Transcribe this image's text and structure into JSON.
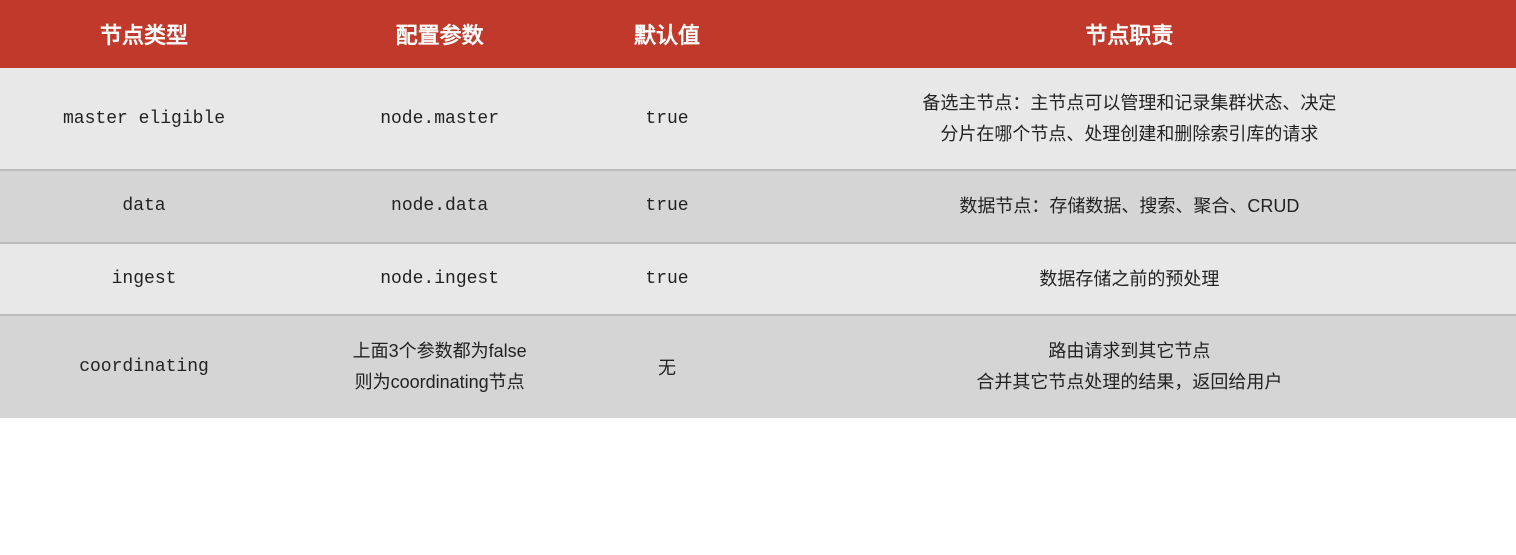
{
  "table": {
    "headers": {
      "col1": "节点类型",
      "col2": "配置参数",
      "col3": "默认值",
      "col4": "节点职责"
    },
    "rows": [
      {
        "type": "master eligible",
        "param": "node.master",
        "default": "true",
        "desc_line1": "备选主节点：主节点可以管理和记录集群状态、决定",
        "desc_line2": "分片在哪个节点、处理创建和删除索引库的请求"
      },
      {
        "type": "data",
        "param": "node.data",
        "default": "true",
        "desc_line1": "数据节点：存储数据、搜索、聚合、CRUD",
        "desc_line2": ""
      },
      {
        "type": "ingest",
        "param": "node.ingest",
        "default": "true",
        "desc_line1": "数据存储之前的预处理",
        "desc_line2": ""
      },
      {
        "type": "coordinating",
        "param_line1": "上面3个参数都为false",
        "param_line2": "则为coordinating节点",
        "default": "无",
        "desc_line1": "路由请求到其它节点",
        "desc_line2": "合并其它节点处理的结果，返回给用户"
      }
    ]
  }
}
